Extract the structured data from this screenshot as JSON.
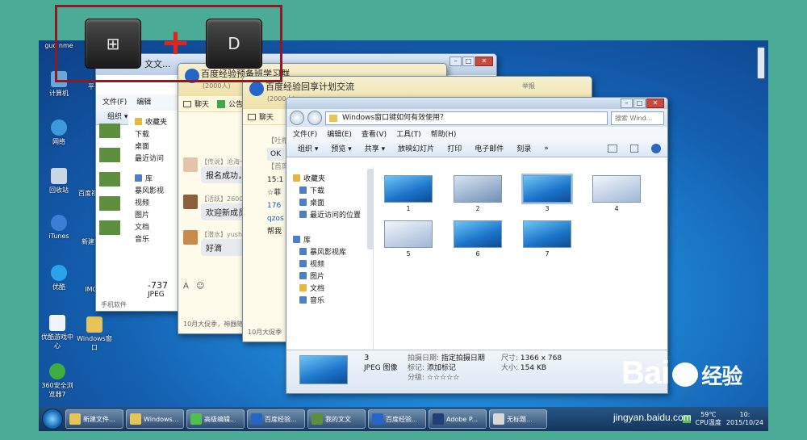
{
  "desktop_icons": [
    {
      "label": "guo nme",
      "top": 1
    },
    {
      "label": "计算机"
    },
    {
      "label": "网络"
    },
    {
      "label": "回收站"
    },
    {
      "label": "iTunes"
    },
    {
      "label": "优酷"
    },
    {
      "label": "优酷游戏中心"
    },
    {
      "label": "360安全浏览器7"
    }
  ],
  "desktop_icons2": [
    "平果",
    "百度视频",
    "新建文",
    "IMG_",
    "Windows窗口"
  ],
  "back_window": {
    "title": "文文...",
    "menu1": "文件(F)",
    "menu2": "编辑",
    "organize": "组织 ▾",
    "nav": [
      "收藏夹",
      "下载",
      "桌面",
      "最近访问",
      "库",
      "暴风影视",
      "视频",
      "图片",
      "文档",
      "音乐"
    ],
    "file": "-737",
    "filetype": "JPEG",
    "footer": "手机软件"
  },
  "qq1": {
    "title": "百度经验预备班学习群",
    "sub": "(2000人)",
    "tabs": [
      "聊天",
      "公告"
    ],
    "messages": [
      {
        "name": "【传说】沧海一",
        "text": "报名成功，"
      },
      {
        "name": "【活跃】26005",
        "text": "欢迎新成员"
      },
      {
        "name": "【潜水】yushc",
        "text": "好滴"
      }
    ],
    "footer": "10月大促季，神器随意"
  },
  "qq2": {
    "title": "百度经验回享计划交流",
    "sub": "(2000人)",
    "tabs": [
      "聊天"
    ],
    "snippets": [
      "【吐槽",
      "OK",
      "【首席",
      "15:1",
      "☆菲",
      "176",
      "qzos",
      "帮我"
    ],
    "labels": [
      "举报"
    ],
    "footer": "10月大促季"
  },
  "explorer": {
    "path": "Windows窗口键如何有效使用？",
    "search": "搜索 Wind...",
    "menus": [
      "文件(F)",
      "编辑(E)",
      "查看(V)",
      "工具(T)",
      "帮助(H)"
    ],
    "toolbar": [
      "组织 ▾",
      "预览 ▾",
      "共享 ▾",
      "放映幻灯片",
      "打印",
      "电子邮件",
      "刻录",
      "»"
    ],
    "nav": [
      "收藏夹",
      "下载",
      "桌面",
      "最近访问的位置",
      "库",
      "暴风影视库",
      "视频",
      "图片",
      "文档",
      "音乐"
    ],
    "thumbs": [
      "1",
      "2",
      "3",
      "4",
      "5",
      "6",
      "7"
    ],
    "details": {
      "name": "3",
      "type": "JPEG 图像",
      "date_label": "拍摄日期:",
      "date_value": "指定拍摄日期",
      "tag_label": "标记:",
      "tag_value": "添加标记",
      "rating_label": "分级:",
      "rating_value": "☆☆☆☆☆",
      "size_label": "尺寸:",
      "size_value": "1366 x 768",
      "filesize_label": "大小:",
      "filesize_value": "154 KB"
    }
  },
  "taskbar": {
    "items": [
      "新建文件...",
      "Windows...",
      "高级编辑...",
      "百度经验...",
      "我的文文",
      "百度经验...",
      "Adobe P...",
      "无标题..."
    ],
    "tray_temp": "59℃",
    "tray_temp_label": "CPU温度",
    "time": "10:",
    "date": "2015/10/24"
  },
  "shortcut": {
    "key1": "⊞",
    "plus": "+",
    "key2": "D"
  },
  "watermark": {
    "brand": "Bai",
    "brand2": "经验",
    "url": "jingyan.baidu.com"
  }
}
